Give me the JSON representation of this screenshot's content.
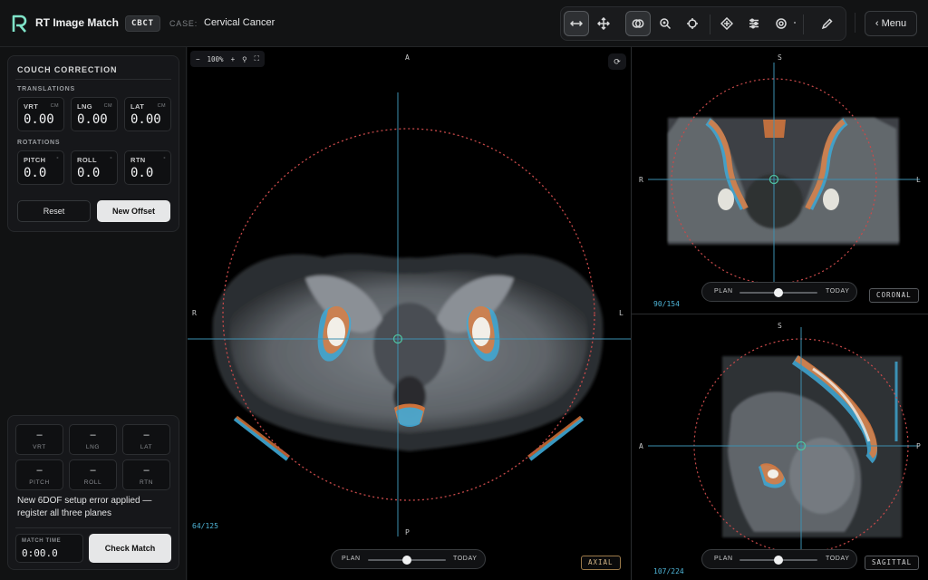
{
  "app": {
    "title": "RT Image Match",
    "modality_badge": "CBCT",
    "case_label": "CASE:",
    "case_value": "Cervical Cancer"
  },
  "toolbar": {
    "tools": [
      {
        "name": "pan-horizontal-icon",
        "active": true
      },
      {
        "name": "move-icon",
        "active": false
      },
      {
        "name": "overlay-icon",
        "active": true
      },
      {
        "name": "zoom-icon",
        "active": false
      },
      {
        "name": "crosshair-icon",
        "active": false
      },
      {
        "name": "target-icon",
        "active": false
      },
      {
        "name": "sliders-icon",
        "active": false
      },
      {
        "name": "contour-icon",
        "active": false
      },
      {
        "name": "pencil-icon",
        "active": false
      }
    ],
    "menu_label": "‹ Menu"
  },
  "couch": {
    "title": "COUCH CORRECTION",
    "translations_label": "TRANSLATIONS",
    "rotations_label": "ROTATIONS",
    "translations": [
      {
        "label": "VRT",
        "unit": "CM",
        "value": "0.00"
      },
      {
        "label": "LNG",
        "unit": "CM",
        "value": "0.00"
      },
      {
        "label": "LAT",
        "unit": "CM",
        "value": "0.00"
      }
    ],
    "rotations": [
      {
        "label": "PITCH",
        "unit": "°",
        "value": "0.0"
      },
      {
        "label": "ROLL",
        "unit": "°",
        "value": "0.0"
      },
      {
        "label": "RTN",
        "unit": "°",
        "value": "0.0"
      }
    ],
    "reset_label": "Reset",
    "new_offset_label": "New Offset"
  },
  "error_panel": {
    "cells": [
      {
        "value": "–",
        "label": "VRT"
      },
      {
        "value": "–",
        "label": "LNG"
      },
      {
        "value": "–",
        "label": "LAT"
      },
      {
        "value": "–",
        "label": "PITCH"
      },
      {
        "value": "–",
        "label": "ROLL"
      },
      {
        "value": "–",
        "label": "RTN"
      }
    ],
    "message": "New 6DOF setup error applied — register all three planes",
    "match_time_label": "MATCH TIME",
    "match_time_value": "0:00.0",
    "check_label": "Check Match"
  },
  "axial": {
    "zoom": "100%",
    "orient": {
      "top": "A",
      "bottom": "P",
      "left": "R",
      "right": "L"
    },
    "slice": "64/125",
    "plane": "AXIAL",
    "blend": {
      "left": "PLAN",
      "right": "TODAY",
      "position": 0.5
    }
  },
  "coronal": {
    "orient": {
      "top": "S",
      "left": "R",
      "right": "L"
    },
    "slice": "90/154",
    "plane": "CORONAL",
    "blend": {
      "left": "PLAN",
      "right": "TODAY",
      "position": 0.5
    }
  },
  "sagittal": {
    "orient": {
      "top": "S",
      "left": "A",
      "right": "P"
    },
    "slice": "107/224",
    "plane": "SAGITTAL",
    "blend": {
      "left": "PLAN",
      "right": "TODAY",
      "position": 0.5
    }
  },
  "colors": {
    "plan": "#e07a3c",
    "today": "#3fa9d6",
    "crosshair": "#3d8fb0",
    "isodose": "#c94a4a"
  }
}
